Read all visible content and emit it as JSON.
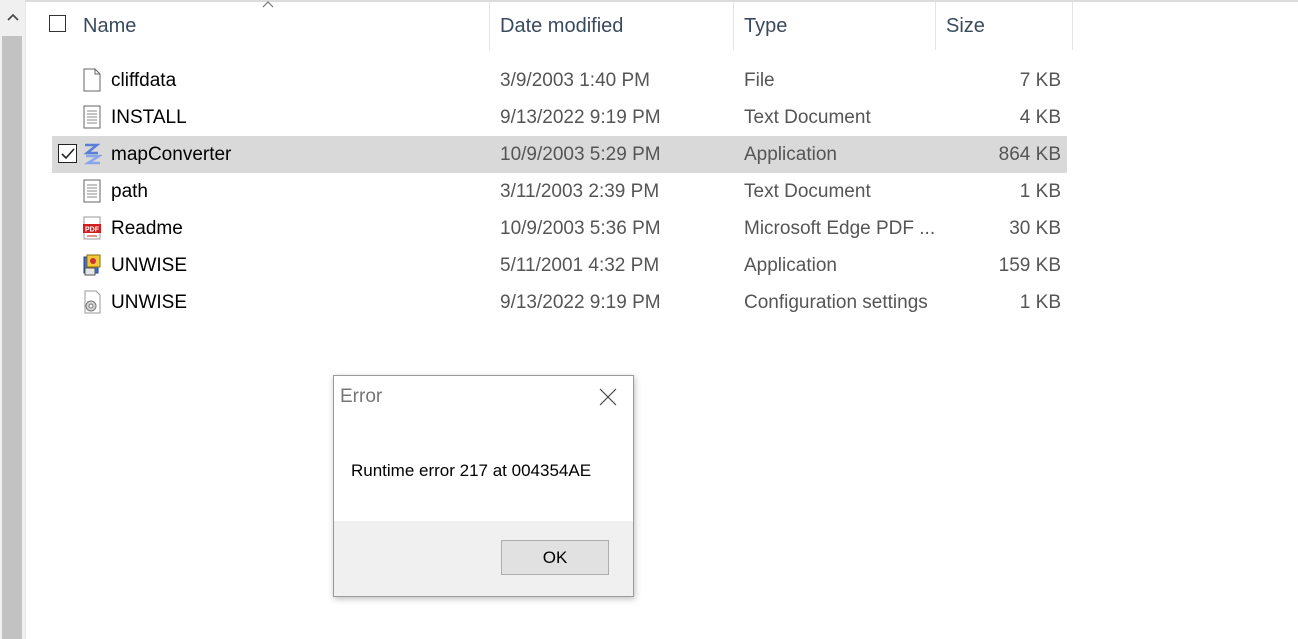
{
  "columns": {
    "name": "Name",
    "date_modified": "Date modified",
    "type": "Type",
    "size": "Size"
  },
  "files": [
    {
      "name": "cliffdata",
      "date": "3/9/2003 1:40 PM",
      "type": "File",
      "size": "7 KB",
      "icon": "blank-file-icon",
      "selected": false
    },
    {
      "name": "INSTALL",
      "date": "9/13/2022 9:19 PM",
      "type": "Text Document",
      "size": "4 KB",
      "icon": "text-document-icon",
      "selected": false
    },
    {
      "name": "mapConverter",
      "date": "10/9/2003 5:29 PM",
      "type": "Application",
      "size": "864 KB",
      "icon": "application-icon",
      "selected": true
    },
    {
      "name": "path",
      "date": "3/11/2003 2:39 PM",
      "type": "Text Document",
      "size": "1 KB",
      "icon": "text-document-icon",
      "selected": false
    },
    {
      "name": "Readme",
      "date": "10/9/2003 5:36 PM",
      "type": "Microsoft Edge PDF ...",
      "size": "30 KB",
      "icon": "pdf-icon",
      "selected": false
    },
    {
      "name": "UNWISE",
      "date": "5/11/2001 4:32 PM",
      "type": "Application",
      "size": "159 KB",
      "icon": "installer-icon",
      "selected": false
    },
    {
      "name": "UNWISE",
      "date": "9/13/2022 9:19 PM",
      "type": "Configuration settings",
      "size": "1 KB",
      "icon": "config-settings-icon",
      "selected": false
    }
  ],
  "pdf_icon_text": "PDF",
  "dialog": {
    "title": "Error",
    "message": "Runtime error 217 at 004354AE",
    "ok_label": "OK"
  },
  "colors": {
    "selected_row": "#d9d9d9",
    "header_text": "#3a4a5e",
    "secondary_text": "#555555"
  }
}
